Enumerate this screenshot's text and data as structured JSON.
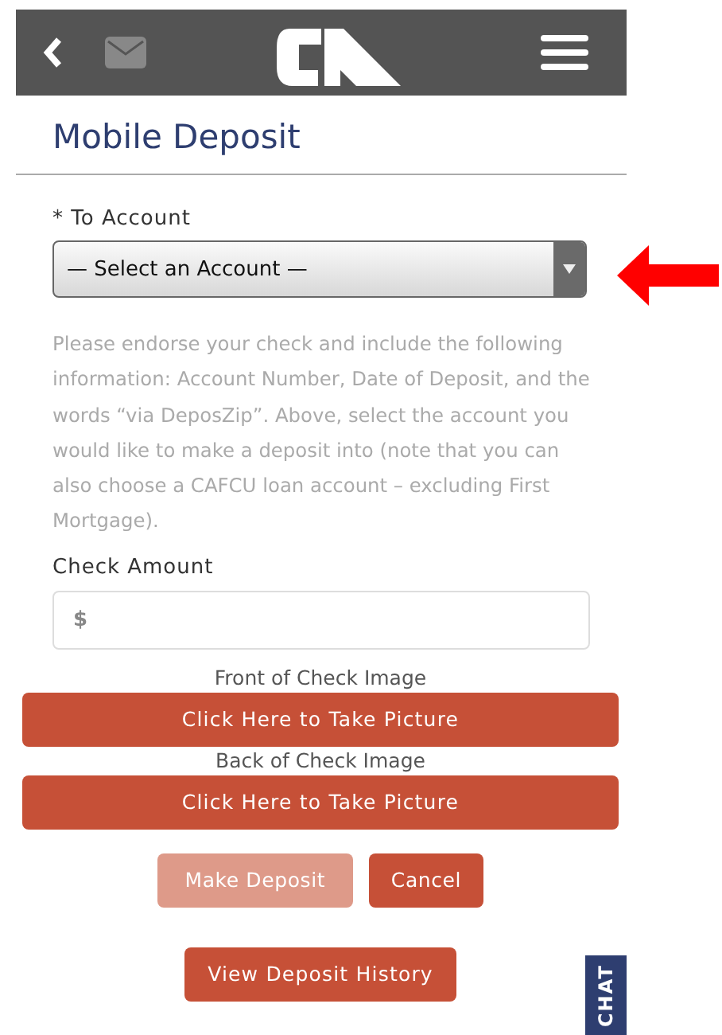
{
  "header": {
    "title": "Mobile Deposit"
  },
  "account": {
    "label": "* To Account",
    "value": "— Select an Account —"
  },
  "instructions": "Please endorse your check and include the following information: Account Number, Date of Deposit, and the words “via DeposZip”. Above, select the account you would like to make a deposit into (note that you can also choose a CAFCU loan account – excluding First Mortgage).",
  "amount": {
    "label": "Check Amount",
    "placeholder": "$"
  },
  "images": [
    {
      "label": "Front of Check Image",
      "button": "Click Here to Take Picture"
    },
    {
      "label": "Back of Check Image",
      "button": "Click Here to Take Picture"
    }
  ],
  "actions": [
    {
      "label": "Make Deposit",
      "disabled": true
    },
    {
      "label": "Cancel",
      "disabled": false
    }
  ],
  "history_button": "View Deposit History",
  "chat_tab": "CHAT"
}
